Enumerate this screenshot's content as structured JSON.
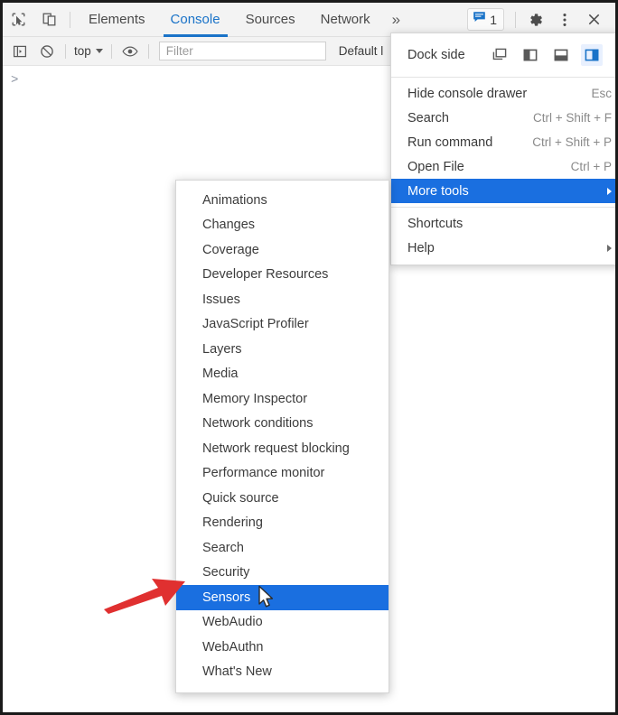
{
  "window": {
    "app": "Chrome DevTools"
  },
  "tabbar": {
    "inspect_icon": "inspect-element-icon",
    "device_icon": "device-toolbar-icon",
    "tabs": [
      {
        "label": "Elements",
        "active": false
      },
      {
        "label": "Console",
        "active": true
      },
      {
        "label": "Sources",
        "active": false
      },
      {
        "label": "Network",
        "active": false
      }
    ],
    "more_tabs_label": "»",
    "issues_count": "1",
    "issues_icon": "issues-message-icon",
    "settings_icon": "gear-icon",
    "main_menu_icon": "kebab-menu-icon",
    "close_icon": "close-icon"
  },
  "console_toolbar": {
    "sidebar_icon": "show-console-sidebar-icon",
    "clear_icon": "clear-console-icon",
    "context_label": "top",
    "eye_icon": "live-expression-eye-icon",
    "filter_placeholder": "Filter",
    "level_label": "Default l"
  },
  "console_body": {
    "prompt": ">"
  },
  "main_menu": {
    "dock_side_label": "Dock side",
    "dock_options": [
      {
        "name": "undock-into-separate-window",
        "active": false
      },
      {
        "name": "dock-to-left",
        "active": false
      },
      {
        "name": "dock-to-bottom",
        "active": false
      },
      {
        "name": "dock-to-right",
        "active": true
      }
    ],
    "items": [
      {
        "label": "Hide console drawer",
        "shortcut": "Esc",
        "highlight": false,
        "submenu": false
      },
      {
        "label": "Search",
        "shortcut": "Ctrl + Shift + F",
        "highlight": false,
        "submenu": false
      },
      {
        "label": "Run command",
        "shortcut": "Ctrl + Shift + P",
        "highlight": false,
        "submenu": false
      },
      {
        "label": "Open File",
        "shortcut": "Ctrl + P",
        "highlight": false,
        "submenu": false
      },
      {
        "label": "More tools",
        "shortcut": "",
        "highlight": true,
        "submenu": true
      }
    ],
    "items_bottom": [
      {
        "label": "Shortcuts",
        "shortcut": "",
        "highlight": false,
        "submenu": false
      },
      {
        "label": "Help",
        "shortcut": "",
        "highlight": false,
        "submenu": true
      }
    ]
  },
  "more_tools_submenu": {
    "items": [
      {
        "label": "Animations",
        "highlight": false
      },
      {
        "label": "Changes",
        "highlight": false
      },
      {
        "label": "Coverage",
        "highlight": false
      },
      {
        "label": "Developer Resources",
        "highlight": false
      },
      {
        "label": "Issues",
        "highlight": false
      },
      {
        "label": "JavaScript Profiler",
        "highlight": false
      },
      {
        "label": "Layers",
        "highlight": false
      },
      {
        "label": "Media",
        "highlight": false
      },
      {
        "label": "Memory Inspector",
        "highlight": false
      },
      {
        "label": "Network conditions",
        "highlight": false
      },
      {
        "label": "Network request blocking",
        "highlight": false
      },
      {
        "label": "Performance monitor",
        "highlight": false
      },
      {
        "label": "Quick source",
        "highlight": false
      },
      {
        "label": "Rendering",
        "highlight": false
      },
      {
        "label": "Search",
        "highlight": false
      },
      {
        "label": "Security",
        "highlight": false
      },
      {
        "label": "Sensors",
        "highlight": true
      },
      {
        "label": "WebAudio",
        "highlight": false
      },
      {
        "label": "WebAuthn",
        "highlight": false
      },
      {
        "label": "What's New",
        "highlight": false
      }
    ]
  },
  "annotations": {
    "arrow_color": "#e03030",
    "arrow_target": "Sensors",
    "cursor_icon": "mouse-pointer-icon"
  },
  "colors": {
    "accent": "#1a73c8",
    "menu_highlight": "#1a6fe0",
    "chrome_bg": "#f3f3f3"
  }
}
